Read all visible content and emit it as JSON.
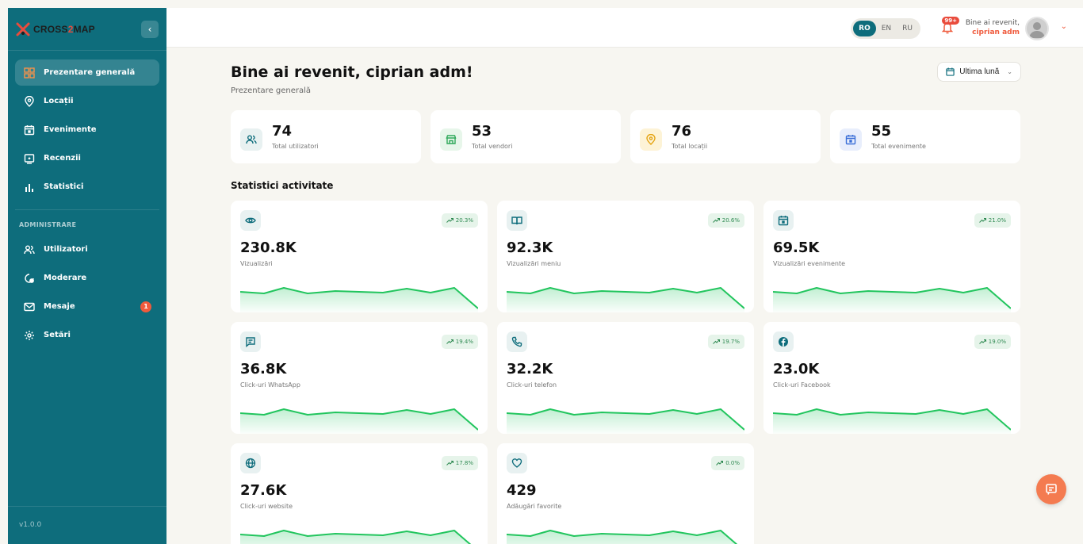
{
  "brand": {
    "name_a": "CROSS",
    "name_b": "2",
    "name_c": "MAP"
  },
  "sidebar": {
    "items": [
      {
        "label": "Prezentare generală",
        "icon": "grid-icon",
        "active": true
      },
      {
        "label": "Locații",
        "icon": "map-pin-icon"
      },
      {
        "label": "Evenimente",
        "icon": "calendar-icon"
      },
      {
        "label": "Recenzii",
        "icon": "review-icon"
      },
      {
        "label": "Statistici",
        "icon": "bar-chart-icon"
      }
    ],
    "section_label": "ADMINISTRARE",
    "admin_items": [
      {
        "label": "Utilizatori",
        "icon": "users-icon"
      },
      {
        "label": "Moderare",
        "icon": "moderation-icon"
      },
      {
        "label": "Mesaje",
        "icon": "mail-icon",
        "badge": "1"
      },
      {
        "label": "Setări",
        "icon": "settings-icon"
      }
    ],
    "version": "v1.0.0"
  },
  "topbar": {
    "languages": [
      "RO",
      "EN",
      "RU"
    ],
    "active_language": "RO",
    "notifications_badge": "99+",
    "greeting": "Bine ai revenit,",
    "username": "ciprian adm"
  },
  "page": {
    "title": "Bine ai revenit, ciprian adm!",
    "subtitle": "Prezentare generală",
    "period": "Ultima lună"
  },
  "summary": [
    {
      "value": "74",
      "label": "Total utilizatori",
      "icon": "users-icon"
    },
    {
      "value": "53",
      "label": "Total vendori",
      "icon": "store-icon"
    },
    {
      "value": "76",
      "label": "Total locații",
      "icon": "map-pin-icon"
    },
    {
      "value": "55",
      "label": "Total evenimente",
      "icon": "calendar-icon"
    }
  ],
  "activity": {
    "title": "Statistici activitate",
    "cards": [
      {
        "value": "230.8K",
        "label": "Vizualizări",
        "trend": "20.3%",
        "icon": "eye-icon"
      },
      {
        "value": "92.3K",
        "label": "Vizualizări meniu",
        "trend": "20.6%",
        "icon": "book-icon"
      },
      {
        "value": "69.5K",
        "label": "Vizualizări evenimente",
        "trend": "21.0%",
        "icon": "calendar-icon"
      },
      {
        "value": "36.8K",
        "label": "Click-uri WhatsApp",
        "trend": "19.4%",
        "icon": "message-icon"
      },
      {
        "value": "32.2K",
        "label": "Click-uri telefon",
        "trend": "19.7%",
        "icon": "phone-icon"
      },
      {
        "value": "23.0K",
        "label": "Click-uri Facebook",
        "trend": "19.0%",
        "icon": "facebook-icon"
      },
      {
        "value": "27.6K",
        "label": "Click-uri website",
        "trend": "17.8%",
        "icon": "globe-icon"
      },
      {
        "value": "429",
        "label": "Adăugări favorite",
        "trend": "0.0%",
        "icon": "heart-icon"
      }
    ]
  },
  "colors": {
    "sidebar": "#0e6d7c",
    "accent": "#ef5a3c",
    "trend_green": "#2f8a52",
    "spark_green": "#22c55e"
  }
}
